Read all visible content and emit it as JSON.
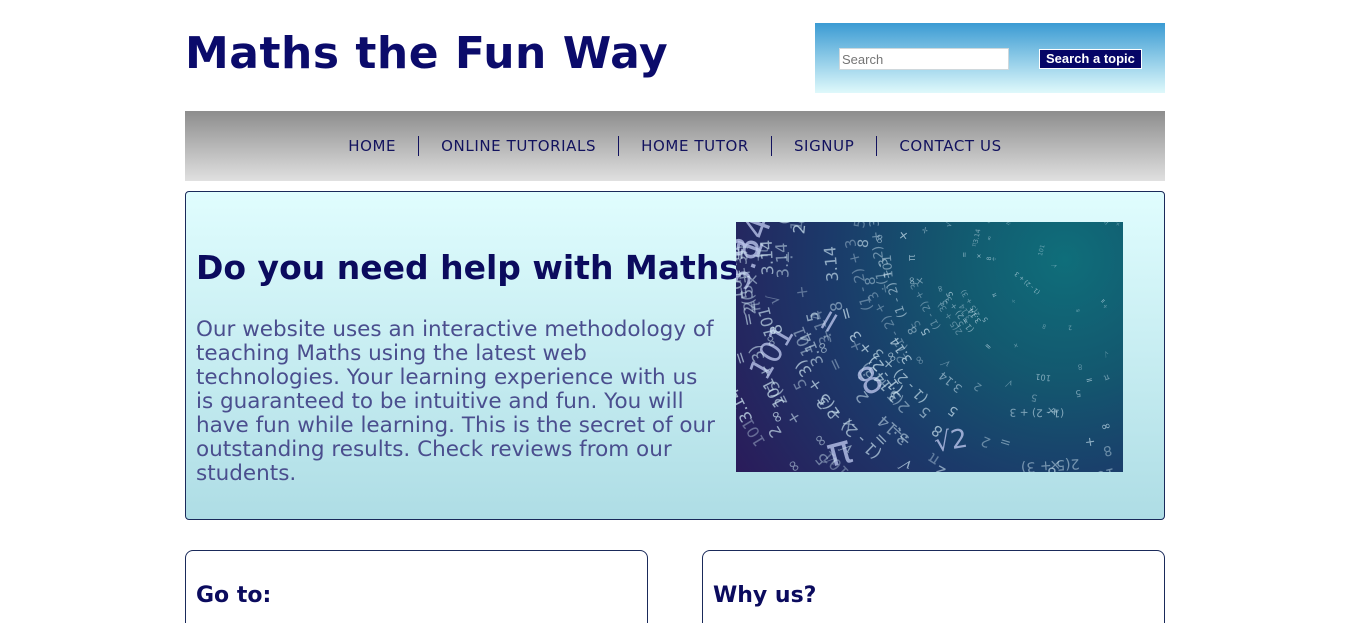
{
  "header": {
    "site_title": "Maths the Fun Way",
    "search_placeholder": "Search",
    "search_button_label": "Search a topic"
  },
  "nav": {
    "items": [
      {
        "label": "HOME"
      },
      {
        "label": "ONLINE TUTORIALS"
      },
      {
        "label": "HOME TUTOR"
      },
      {
        "label": "SIGNUP"
      },
      {
        "label": "CONTACT US"
      }
    ]
  },
  "hero": {
    "title": "Do you need help with Maths?",
    "text": "Our website uses an interactive methodology of teaching Maths using the latest web technologies. Your learning experience with us is guaranteed to be intuitive and fun. You will have fun while learning. This is the secret of our outstanding results. Check reviews from our students.",
    "image_glyphs": [
      "101",
      "3.14",
      "8",
      "∞",
      "π",
      "√",
      "÷",
      "×",
      "+",
      "=",
      "5",
      "2",
      "(1 - 2) + 3",
      "2(5 + 3)"
    ]
  },
  "cards": {
    "goto_title": "Go to:",
    "why_title": "Why us?"
  },
  "colors": {
    "title": "#0b0b6b",
    "nav_text": "#12125e",
    "body_text": "#4a4e8e",
    "search_button_bg": "#050566"
  }
}
